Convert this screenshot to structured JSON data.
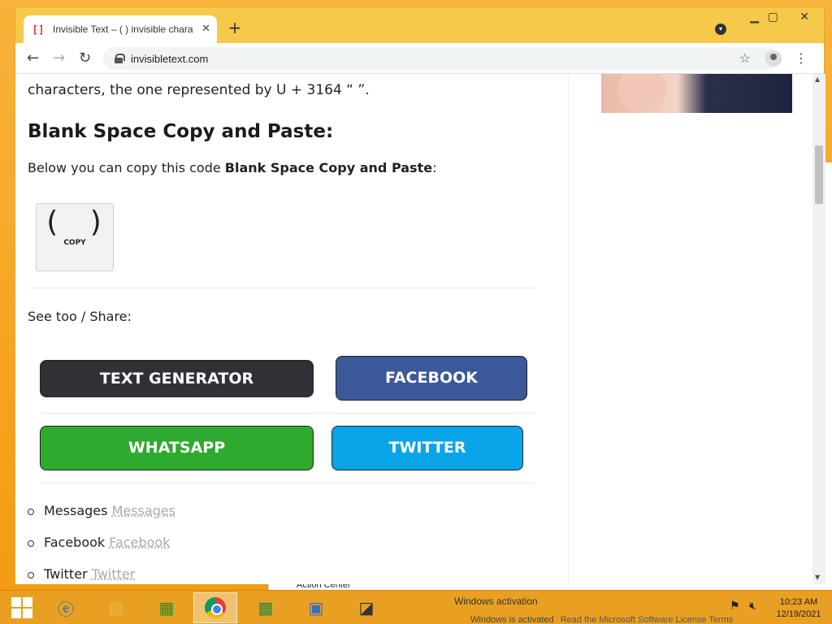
{
  "browser": {
    "tab_title": "Invisible Text – (   ) invisible chara",
    "tab_close": "✕",
    "new_tab": "+",
    "url": "invisibletext.com",
    "window_controls": {
      "minimize": "▁",
      "maximize": "▢",
      "close": "✕"
    }
  },
  "page": {
    "para_top": "characters, the one represented by U + 3164 “    ”.",
    "heading": "Blank Space Copy and Paste:",
    "para2_prefix": "Below you can copy this code ",
    "para2_bold": "Blank Space Copy and Paste",
    "para2_suffix": ":",
    "copy_box": {
      "symbol": "( )",
      "label": "COPY"
    },
    "share_label": "See too / Share:",
    "buttons": {
      "text_generator": "TEXT GENERATOR",
      "facebook": "FACEBOOK",
      "whatsapp": "WHATSAPP",
      "twitter": "TWITTER"
    },
    "share_list": [
      {
        "label": "Messages",
        "ghost": "Messages"
      },
      {
        "label": "Facebook",
        "ghost": "Facebook"
      },
      {
        "label": "Twitter",
        "ghost": "Twitter"
      }
    ]
  },
  "desktop": {
    "action_center": "Action Center",
    "activation_title": "Windows activation",
    "activation_line": "Windows is activated",
    "activation_link": "Read the Microsoft Software License Terms"
  },
  "taskbar": {
    "icons": [
      "start-icon",
      "internet-explorer-icon",
      "file-explorer-icon",
      "store-icon",
      "chrome-icon",
      "app-icon",
      "network-app-icon",
      "remote-desktop-icon"
    ],
    "clock_time": "10:23 AM",
    "clock_date": "12/19/2021"
  },
  "colors": {
    "text_generator": "#2f3136",
    "facebook": "#3b5998",
    "whatsapp": "#2eaa2e",
    "twitter": "#0aa4e8",
    "titlebar": "#f6c94a"
  }
}
